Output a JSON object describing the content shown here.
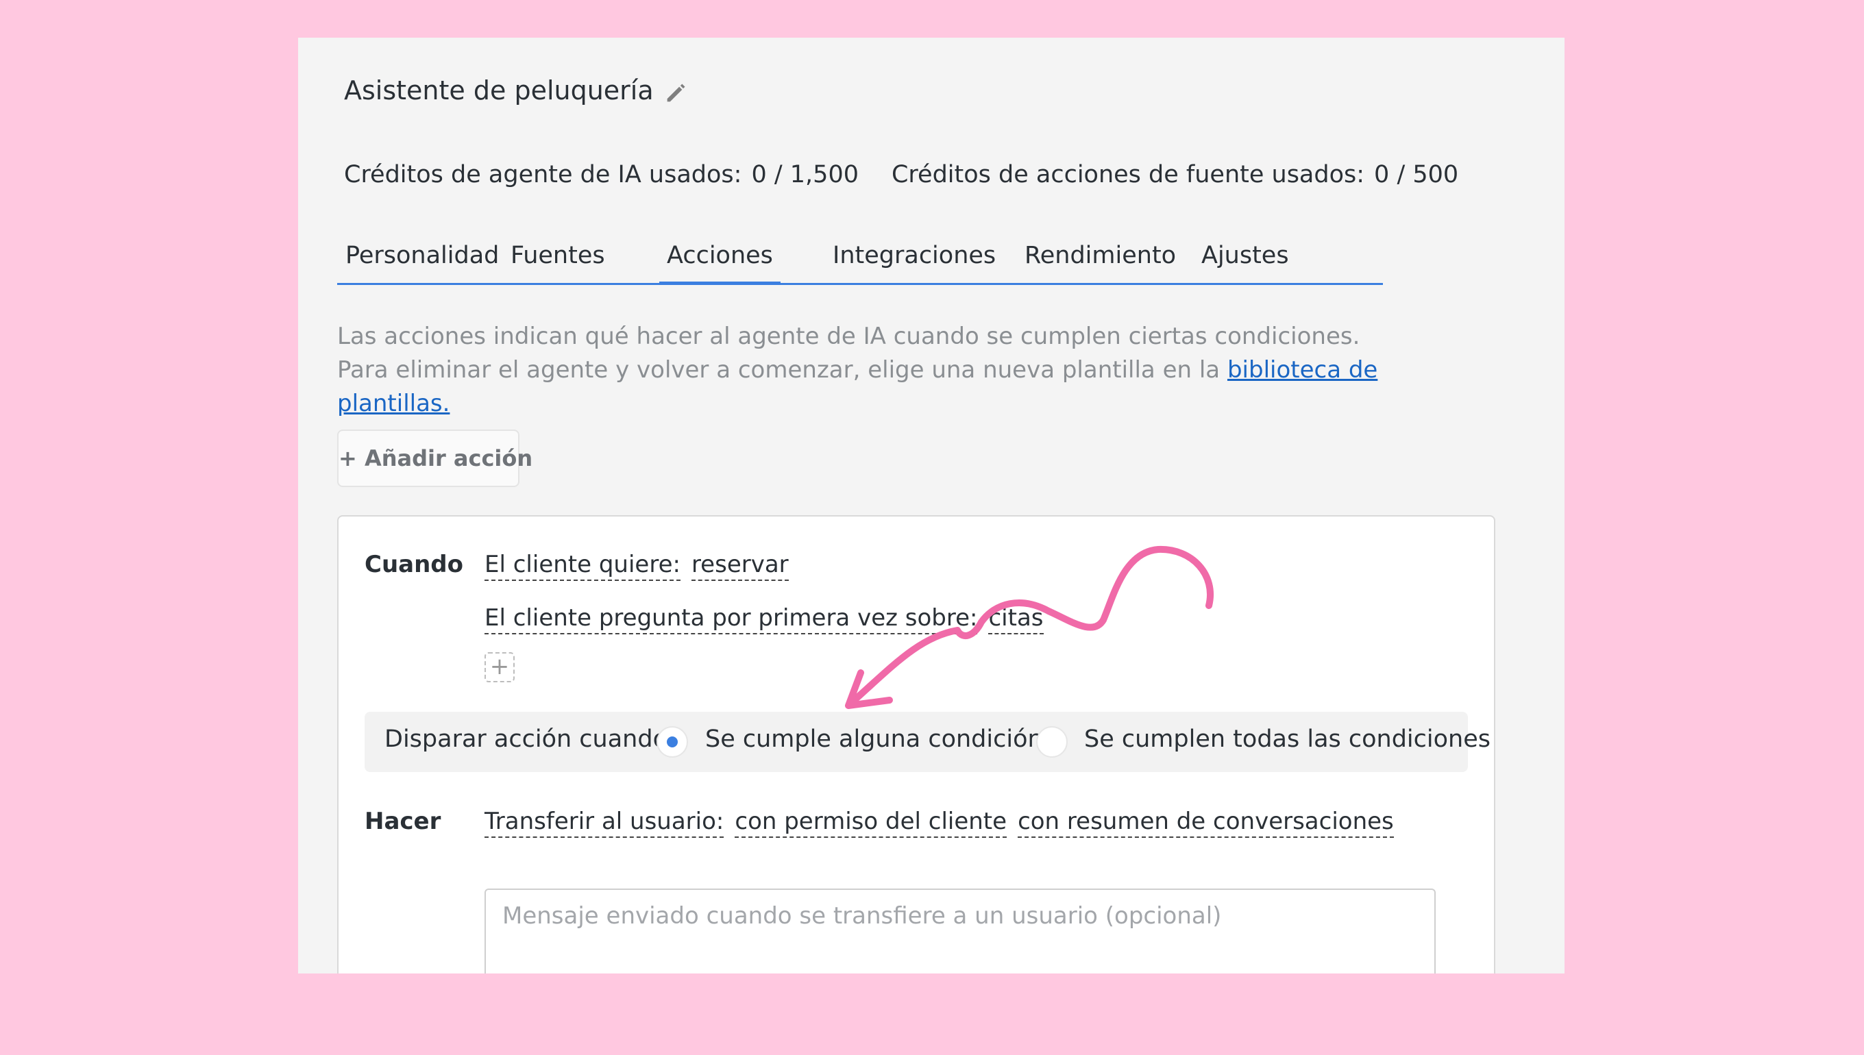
{
  "header": {
    "title": "Asistente de peluquería",
    "edit_icon": "pencil-icon"
  },
  "credits": {
    "ai_label": "Créditos de agente de IA usados:",
    "ai_value": "0 / 1,500",
    "source_label": "Créditos de acciones de fuente usados:",
    "source_value": "0 / 500"
  },
  "tabs": [
    {
      "label": "Personalidad"
    },
    {
      "label": "Fuentes"
    },
    {
      "label": "Acciones",
      "active": true
    },
    {
      "label": "Integraciones"
    },
    {
      "label": "Rendimiento"
    },
    {
      "label": "Ajustes"
    }
  ],
  "description": {
    "text": "Las acciones indican qué hacer al agente de IA cuando se cumplen ciertas condiciones. Para eliminar el agente y volver a comenzar, elige una nueva plantilla en la",
    "link": "biblioteca de plantillas."
  },
  "add_action_label": "+ Añadir acción",
  "action": {
    "when_label": "Cuando",
    "conditions": [
      {
        "field": "El cliente quiere:",
        "value": "reservar"
      },
      {
        "field": "El cliente pregunta por primera vez sobre:",
        "value": "citas"
      }
    ],
    "add_condition_label": "+",
    "trigger": {
      "label": "Disparar acción cuando:",
      "options": [
        {
          "label": "Se cumple alguna condición",
          "selected": true
        },
        {
          "label": "Se cumplen todas las condiciones",
          "selected": false
        }
      ]
    },
    "do_label": "Hacer",
    "do_items": {
      "action": "Transferir al usuario:",
      "opt1": "con permiso del cliente",
      "opt2": "con resumen de conversaciones"
    },
    "message_placeholder": "Mensaje enviado cuando se transfiere a un usuario (opcional)"
  },
  "colors": {
    "background": "#ffc8e0",
    "panel": "#f4f4f4",
    "accent": "#3b7fe0",
    "link": "#1a66c4",
    "annotation": "#f06aa8"
  }
}
